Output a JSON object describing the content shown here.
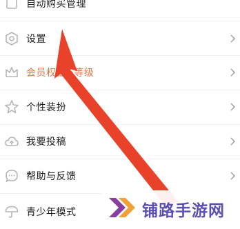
{
  "menu": {
    "items": [
      {
        "label": "自动购买管理",
        "icon": "cart-icon"
      },
      {
        "label": "设置",
        "icon": "settings-icon"
      },
      {
        "label": "会员权益&等级",
        "icon": "crown-icon"
      },
      {
        "label": "个性装扮",
        "icon": "star-icon"
      },
      {
        "label": "我要投稿",
        "icon": "cloud-upload-icon"
      },
      {
        "label": "帮助与反馈",
        "icon": "chat-bubble-icon"
      },
      {
        "label": "青少年模式",
        "icon": "umbrella-icon"
      }
    ]
  },
  "watermark": {
    "text": "铺路手游网",
    "icon": "double-chevron-logo"
  },
  "colors": {
    "text": "#222222",
    "vip_text": "#e8764a",
    "icon": "#b5b5b5",
    "arrow": "#e8432a",
    "watermark_text": "#5a4fb4",
    "watermark_logo_dark": "#8a3fa0",
    "watermark_logo_light": "#f0a23a"
  }
}
